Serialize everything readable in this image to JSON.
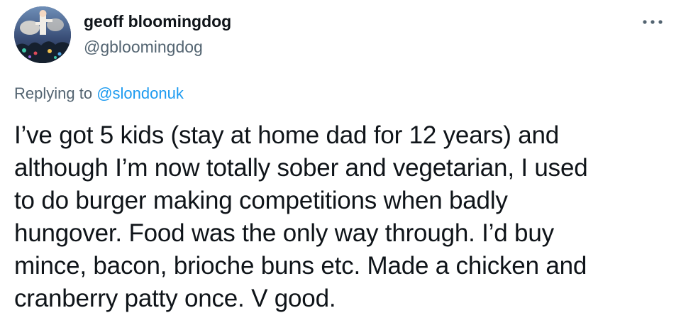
{
  "author": {
    "display_name": "geoff bloomingdog",
    "handle": "@gbloomingdog",
    "avatar_icon": "profile-photo"
  },
  "menu": {
    "more_icon": "ellipsis-icon"
  },
  "reply": {
    "prefix": "Replying to ",
    "to_handle": "@slondonuk"
  },
  "tweet": {
    "text": "I’ve got 5 kids (stay at home dad for 12 years) and\nalthough I’m now totally sober and vegetarian, I used\nto do burger making competitions when badly\nhungover. Food was the only way through. I’d buy\nmince, bacon, brioche buns etc. Made a chicken and\ncranberry patty once. V good."
  },
  "colors": {
    "text_primary": "#0f1419",
    "text_secondary": "#536471",
    "link": "#1d9bf0",
    "background": "#ffffff"
  }
}
